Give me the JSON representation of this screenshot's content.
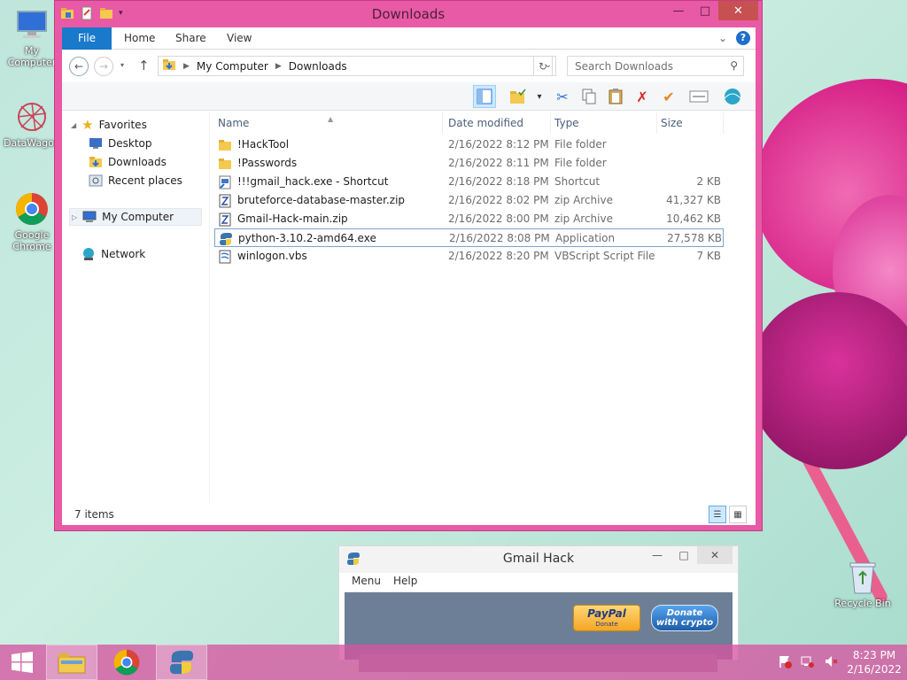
{
  "desktop": {
    "icons": [
      {
        "label": "My Computer",
        "icon": "computer-icon"
      },
      {
        "label": "DataWagon",
        "icon": "datawagon-icon"
      },
      {
        "label": "Google Chrome",
        "icon": "chrome-icon"
      },
      {
        "label": "Recycle Bin",
        "icon": "recycle-bin-icon"
      }
    ]
  },
  "explorer": {
    "title": "Downloads",
    "ribbon_tabs": [
      "File",
      "Home",
      "Share",
      "View"
    ],
    "address": {
      "segments": [
        "My Computer",
        "Downloads"
      ]
    },
    "search_placeholder": "Search Downloads",
    "nav": {
      "favorites": "Favorites",
      "favorite_items": [
        "Desktop",
        "Downloads",
        "Recent places"
      ],
      "computer": "My Computer",
      "network": "Network"
    },
    "columns": [
      "Name",
      "Date modified",
      "Type",
      "Size"
    ],
    "files": [
      {
        "name": "!HackTool",
        "date": "2/16/2022 8:12 PM",
        "type": "File folder",
        "size": "",
        "icon": "folder-icon"
      },
      {
        "name": "!Passwords",
        "date": "2/16/2022 8:11 PM",
        "type": "File folder",
        "size": "",
        "icon": "folder-icon"
      },
      {
        "name": "!!!gmail_hack.exe - Shortcut",
        "date": "2/16/2022 8:18 PM",
        "type": "Shortcut",
        "size": "2 KB",
        "icon": "shortcut-icon"
      },
      {
        "name": "bruteforce-database-master.zip",
        "date": "2/16/2022 8:02 PM",
        "type": "zip Archive",
        "size": "41,327 KB",
        "icon": "zip-icon"
      },
      {
        "name": "Gmail-Hack-main.zip",
        "date": "2/16/2022 8:00 PM",
        "type": "zip Archive",
        "size": "10,462 KB",
        "icon": "zip-icon"
      },
      {
        "name": "python-3.10.2-amd64.exe",
        "date": "2/16/2022 8:08 PM",
        "type": "Application",
        "size": "27,578 KB",
        "icon": "python-installer-icon"
      },
      {
        "name": "winlogon.vbs",
        "date": "2/16/2022 8:20 PM",
        "type": "VBScript Script File",
        "size": "7 KB",
        "icon": "vbs-script-icon"
      }
    ],
    "selected_index": 5,
    "status": "7 items"
  },
  "gmail_hack": {
    "title": "Gmail Hack",
    "menu": [
      "Menu",
      "Help"
    ],
    "paypal": {
      "line1": "PayPal",
      "line2": "Donate"
    },
    "crypto": {
      "line1": "Donate",
      "line2": "with crypto"
    }
  },
  "taskbar": {
    "time": "8:23 PM",
    "date": "2/16/2022"
  },
  "colors": {
    "window_frame": "#e85aa5",
    "file_tab": "#1979ca",
    "taskbar": "#d654a0"
  }
}
